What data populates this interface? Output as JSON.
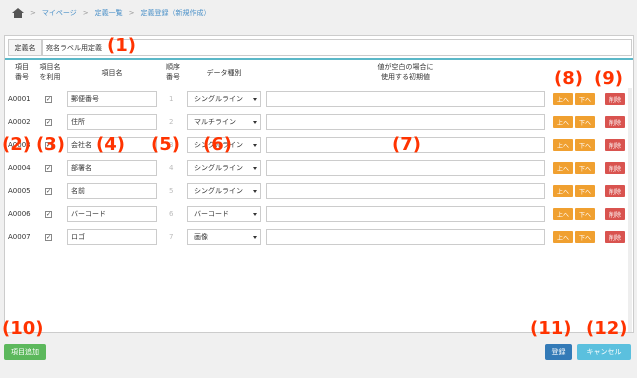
{
  "breadcrumb": {
    "items": [
      "マイページ",
      "定義一覧",
      "定義登録（新規作成）"
    ],
    "sep": ">"
  },
  "form": {
    "name_label": "定義名",
    "name_value": "宛名ラベル用定義"
  },
  "headers": {
    "item_no": [
      "項目",
      "番号"
    ],
    "use_name": [
      "項目名",
      "を利用"
    ],
    "item_name": "項目名",
    "order": [
      "順序",
      "番号"
    ],
    "data_type": "データ種別",
    "default_value": [
      "値が空白の場合に",
      "使用する初期値"
    ]
  },
  "rows": [
    {
      "id": "A0001",
      "checked": "✓",
      "name": "郵便番号",
      "order": "1",
      "type": "シングルライン"
    },
    {
      "id": "A0002",
      "checked": "✓",
      "name": "住所",
      "order": "2",
      "type": "マルチライン"
    },
    {
      "id": "A0003",
      "checked": "✓",
      "name": "会社名",
      "order": "3",
      "type": "シングルライン"
    },
    {
      "id": "A0004",
      "checked": "✓",
      "name": "部署名",
      "order": "4",
      "type": "シングルライン"
    },
    {
      "id": "A0005",
      "checked": "✓",
      "name": "名前",
      "order": "5",
      "type": "シングルライン"
    },
    {
      "id": "A0006",
      "checked": "✓",
      "name": "バーコード",
      "order": "6",
      "type": "バーコード"
    },
    {
      "id": "A0007",
      "checked": "✓",
      "name": "ロゴ",
      "order": "7",
      "type": "画像"
    }
  ],
  "row_buttons": {
    "up": "上へ",
    "down": "下へ",
    "delete": "削除"
  },
  "footer": {
    "add_item": "項目追加",
    "register": "登録",
    "cancel": "キャンセル"
  },
  "annotations": [
    "(1)",
    "(2)",
    "(3)",
    "(4)",
    "(5)",
    "(6)",
    "(7)",
    "(8)",
    "(9)",
    "(10)",
    "(11)",
    "(12)"
  ],
  "colors": {
    "accent_line": "#5bb8c8",
    "up_down": "#f0a030",
    "delete": "#d9534f",
    "add_button": "#5cb85c",
    "register_button": "#337ab7",
    "cancel_button": "#5bc0de",
    "annotation": "#ff3300"
  }
}
